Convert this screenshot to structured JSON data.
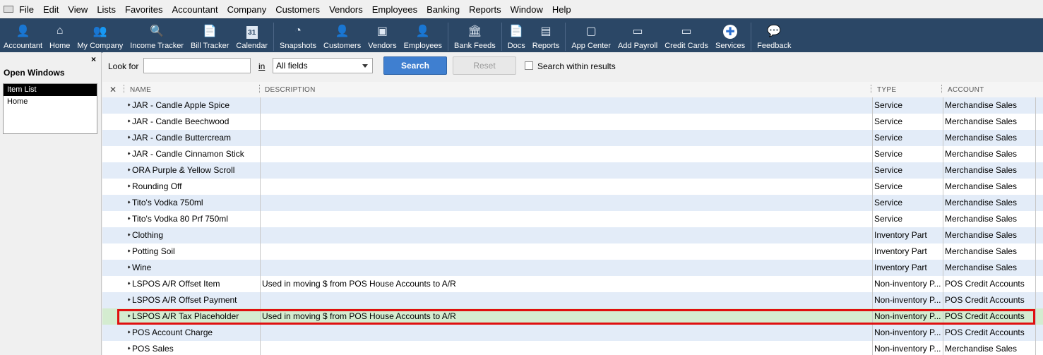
{
  "menu": [
    "File",
    "Edit",
    "View",
    "Lists",
    "Favorites",
    "Accountant",
    "Company",
    "Customers",
    "Vendors",
    "Employees",
    "Banking",
    "Reports",
    "Window",
    "Help"
  ],
  "toolbar": [
    {
      "label": "Accountant",
      "icon": "accountant-icon"
    },
    {
      "label": "Home",
      "icon": "home-icon"
    },
    {
      "label": "My Company",
      "icon": "my-company-icon"
    },
    {
      "label": "Income Tracker",
      "icon": "income-tracker-icon"
    },
    {
      "label": "Bill Tracker",
      "icon": "bill-tracker-icon"
    },
    {
      "label": "Calendar",
      "icon": "calendar-icon"
    },
    {
      "label": "Snapshots",
      "icon": "snapshots-icon"
    },
    {
      "label": "Customers",
      "icon": "customers-icon"
    },
    {
      "label": "Vendors",
      "icon": "vendors-icon"
    },
    {
      "label": "Employees",
      "icon": "employees-icon"
    },
    {
      "label": "Bank Feeds",
      "icon": "bank-feeds-icon"
    },
    {
      "label": "Docs",
      "icon": "docs-icon"
    },
    {
      "label": "Reports",
      "icon": "reports-icon"
    },
    {
      "label": "App Center",
      "icon": "app-center-icon"
    },
    {
      "label": "Add Payroll",
      "icon": "add-payroll-icon"
    },
    {
      "label": "Credit Cards",
      "icon": "credit-cards-icon"
    },
    {
      "label": "Services",
      "icon": "services-icon"
    },
    {
      "label": "Feedback",
      "icon": "feedback-icon"
    }
  ],
  "open_windows": {
    "title": "Open Windows",
    "close": "×",
    "items": [
      {
        "label": "Item List",
        "selected": true
      },
      {
        "label": "Home",
        "selected": false
      }
    ]
  },
  "search": {
    "look_for_label": "Look for",
    "look_for_value": "",
    "in_label": "in",
    "field_select": "All fields",
    "search_button": "Search",
    "reset_button": "Reset",
    "within_results_label": "Search within results",
    "within_results_checked": false
  },
  "table": {
    "columns": {
      "name": "NAME",
      "description": "DESCRIPTION",
      "type": "TYPE",
      "account": "ACCOUNT"
    },
    "rows": [
      {
        "name": "JAR - Candle Apple Spice",
        "description": "",
        "type": "Service",
        "account": "Merchandise Sales"
      },
      {
        "name": "JAR - Candle Beechwood",
        "description": "",
        "type": "Service",
        "account": "Merchandise Sales"
      },
      {
        "name": "JAR - Candle Buttercream",
        "description": "",
        "type": "Service",
        "account": "Merchandise Sales"
      },
      {
        "name": "JAR - Candle Cinnamon Stick",
        "description": "",
        "type": "Service",
        "account": "Merchandise Sales"
      },
      {
        "name": "ORA Purple & Yellow Scroll",
        "description": "",
        "type": "Service",
        "account": "Merchandise Sales"
      },
      {
        "name": "Rounding Off",
        "description": "",
        "type": "Service",
        "account": "Merchandise Sales"
      },
      {
        "name": "Tito's Vodka 750ml",
        "description": "",
        "type": "Service",
        "account": "Merchandise Sales"
      },
      {
        "name": "Tito's Vodka 80 Prf 750ml",
        "description": "",
        "type": "Service",
        "account": "Merchandise Sales"
      },
      {
        "name": "Clothing",
        "description": "",
        "type": "Inventory Part",
        "account": "Merchandise Sales"
      },
      {
        "name": "Potting Soil",
        "description": "",
        "type": "Inventory Part",
        "account": "Merchandise Sales"
      },
      {
        "name": "Wine",
        "description": "",
        "type": "Inventory Part",
        "account": "Merchandise Sales"
      },
      {
        "name": "LSPOS A/R Offset Item",
        "description": "Used in moving $ from POS House Accounts to A/R",
        "type": "Non-inventory P...",
        "account": "POS Credit Accounts"
      },
      {
        "name": "LSPOS A/R Offset Payment",
        "description": "",
        "type": "Non-inventory P...",
        "account": "POS Credit Accounts"
      },
      {
        "name": "LSPOS A/R Tax Placeholder",
        "description": "Used in moving $ from POS House Accounts to A/R",
        "type": "Non-inventory P...",
        "account": "POS Credit Accounts",
        "highlighted": true
      },
      {
        "name": "POS Account Charge",
        "description": "",
        "type": "Non-inventory P...",
        "account": "POS Credit Accounts"
      },
      {
        "name": "POS Sales",
        "description": "",
        "type": "Non-inventory P...",
        "account": "Merchandise Sales"
      }
    ]
  }
}
